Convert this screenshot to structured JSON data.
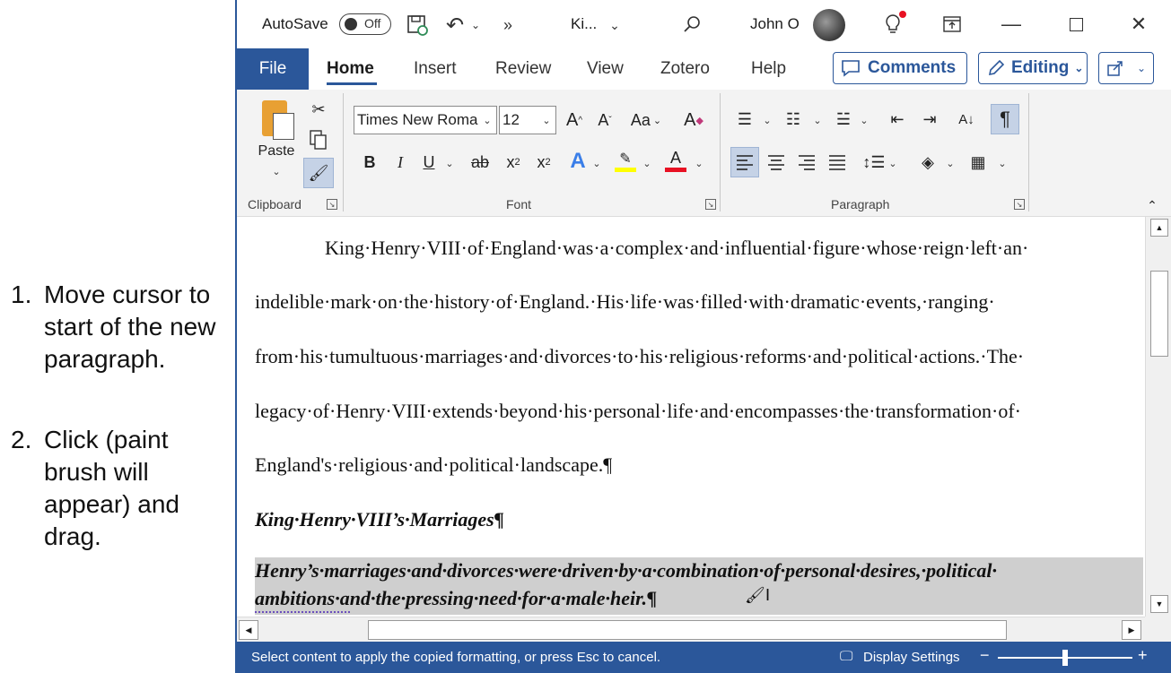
{
  "instructions": {
    "step1": {
      "num": "1.",
      "lines": [
        "Move cursor to",
        "start of the new",
        "paragraph."
      ]
    },
    "step2": {
      "num": "2.",
      "lines": [
        "Click (paint",
        "brush will",
        "appear) and",
        "drag."
      ]
    }
  },
  "titlebar": {
    "autosave_label": "AutoSave",
    "autosave_state": "Off",
    "doc_title": "Ki...",
    "user_name": "John O",
    "icons": [
      "save-icon",
      "undo-icon",
      "more-icon",
      "search-icon",
      "lightbulb-icon",
      "ribbon-display-icon",
      "minimize-icon",
      "maximize-icon",
      "close-icon"
    ]
  },
  "tabs": {
    "file": "File",
    "items": [
      "Home",
      "Insert",
      "Review",
      "View",
      "Zotero",
      "Help"
    ],
    "active": "Home",
    "comments": "Comments",
    "editing": "Editing"
  },
  "ribbon": {
    "clipboard": {
      "paste": "Paste",
      "label": "Clipboard"
    },
    "font": {
      "name": "Times New Roma",
      "size": "12",
      "label": "Font",
      "case": "Aa"
    },
    "paragraph": {
      "label": "Paragraph"
    },
    "colors": {
      "highlight": "#ffff00",
      "font_color": "#e81123",
      "accent": "#2b579a"
    }
  },
  "document": {
    "lines": [
      "King·Henry·VIII·of·England·was·a·complex·and·influential·figure·whose·reign·left·an·",
      "indelible·mark·on·the·history·of·England.·His·life·was·filled·with·dramatic·events,·ranging·",
      "from·his·tumultuous·marriages·and·divorces·to·his·religious·reforms·and·political·actions.·The·",
      "legacy·of·Henry·VIII·extends·beyond·his·personal·life·and·encompasses·the·transformation·of·",
      "England's·religious·and·political·landscape.¶"
    ],
    "heading": "King·Henry·VIII’s·Marriages¶",
    "selected": [
      "Henry’s·marriages·and·divorces·were·driven·by·a·combination·of·personal·desires,·political·",
      "ambitions·and·the·pressing·need·for·a·male·heir.¶"
    ]
  },
  "statusbar": {
    "message": "Select content to apply the copied formatting, or press Esc to cancel.",
    "display_settings": "Display Settings",
    "zoom_minus": "−",
    "zoom_plus": "+"
  }
}
